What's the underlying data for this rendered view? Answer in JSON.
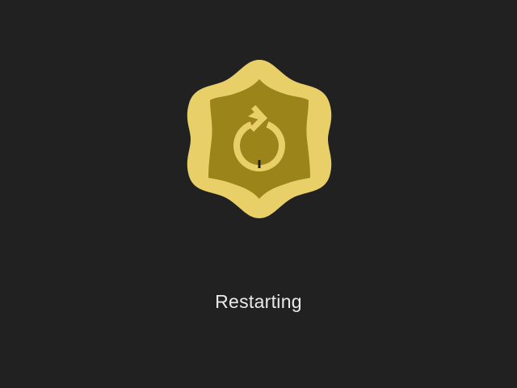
{
  "status": {
    "label": "Restarting",
    "icon": "restart-icon"
  },
  "colors": {
    "background": "#212121",
    "badge_outer": "#e8cf67",
    "badge_inner": "#9b841a",
    "icon": "#e8cf67",
    "text": "#e9e9e9"
  }
}
